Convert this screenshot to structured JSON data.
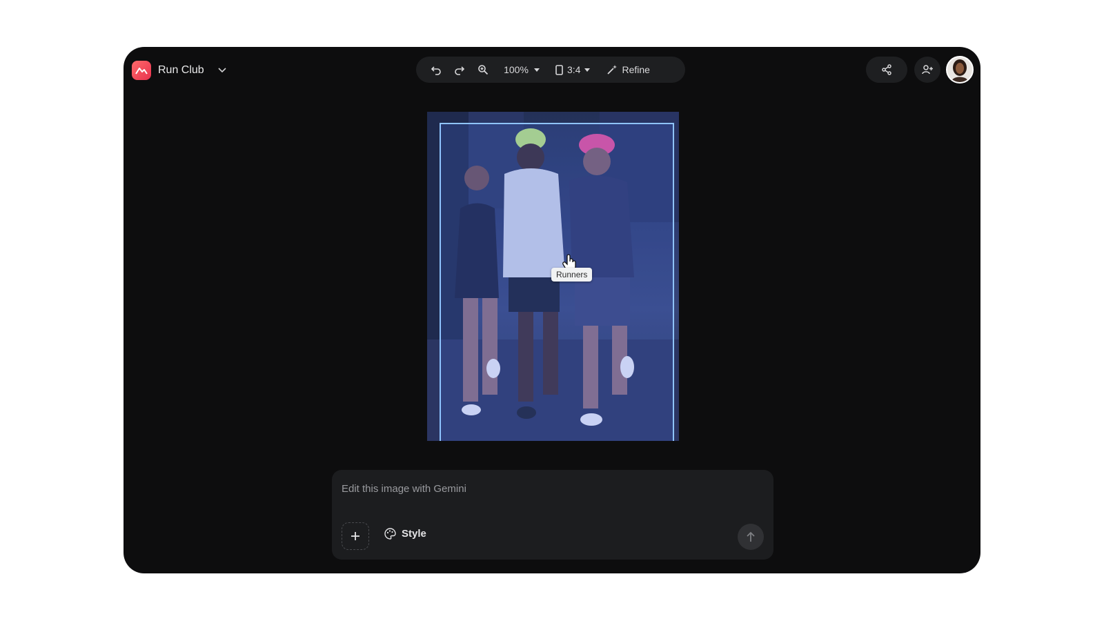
{
  "project": {
    "title": "Run Club",
    "logo": "mountain-logo-icon",
    "menu_icon": "chevron-down-icon"
  },
  "toolbar": {
    "undo_icon": "undo-icon",
    "redo_icon": "redo-icon",
    "zoom_icon": "zoom-in-icon",
    "zoom_level": "100%",
    "aspect_ratio": "3:4",
    "refine_label": "Refine"
  },
  "header_actions": {
    "share_icon": "share-icon",
    "add_person_icon": "add-person-icon"
  },
  "canvas": {
    "tooltip": "Runners"
  },
  "prompt": {
    "placeholder": "Edit this image with Gemini",
    "style_label": "Style"
  },
  "colors": {
    "app_background": "#0d0d0e",
    "panel": "#1e1f21",
    "selection": "#8fc4ff",
    "logo": "#e8324e"
  }
}
